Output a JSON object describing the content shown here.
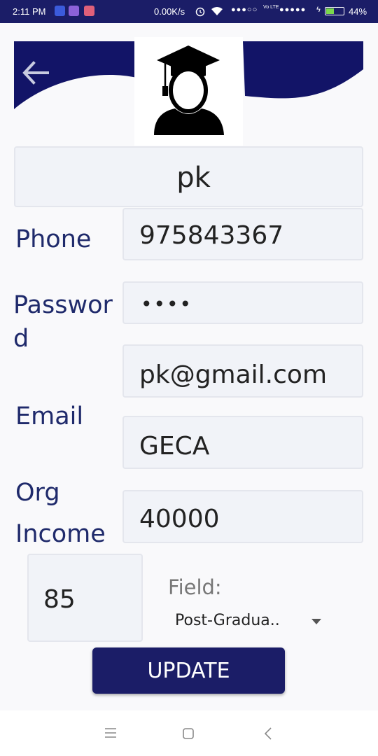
{
  "status_bar": {
    "time": "2:11 PM",
    "network_speed": "0.00K/s",
    "signal_1": "●●●○○",
    "network_type": "Vo LTE",
    "signal_2": "●●●●●",
    "battery_percent": "44%",
    "battery_level": 0.44,
    "notification_colors": [
      "#3b5bdb",
      "#8c62d8",
      "#e0607a"
    ]
  },
  "header": {
    "back_icon": "arrow-left-icon",
    "avatar_icon": "graduate-user-icon",
    "wave_color": "#121467"
  },
  "profile": {
    "name": "pk",
    "phone_label": "Phone",
    "phone": "975843367",
    "password_label_1": "Passwor",
    "password_label_2": "d",
    "password": "••••",
    "email_label": "Email",
    "email": "pk@gmail.com",
    "org_label": "Org",
    "org": "GECA",
    "income_label": "Income",
    "income": "40000",
    "score": "85",
    "field_label": "Field:",
    "field_value": "Post-Gradua.."
  },
  "actions": {
    "update_label": "UPDATE"
  },
  "nav_bar": {
    "menu_icon": "menu-icon",
    "home_icon": "square-home-icon",
    "back_icon": "chevron-left-icon"
  }
}
